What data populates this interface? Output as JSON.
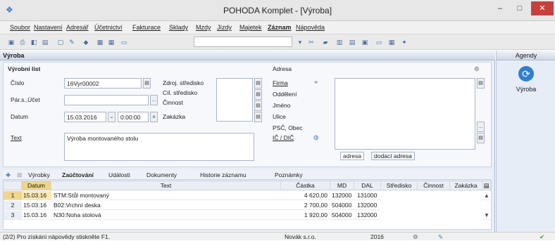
{
  "window": {
    "title": "POHODA Komplet - [Výroba]",
    "min": "–",
    "max": "□",
    "close": "✕"
  },
  "menu": [
    "Soubor",
    "Nastavení",
    "Adresář",
    "Účetnictví",
    "Fakturace",
    "Sklady",
    "Mzdy",
    "Jízdy",
    "Majetek",
    "Záznam",
    "Nápověda"
  ],
  "form": {
    "panel_title": "Výroba",
    "section": "Výrobní list",
    "cislo_label": "Číslo",
    "cislo": "16Vyr00002",
    "pars_label": "Pár.s.,Účet",
    "datum_label": "Datum",
    "datum": "15.03.2016",
    "cas": "0:00:00",
    "text_label": "Text",
    "text": "Výroba montovaného stolu",
    "zdroj_label": "Zdroj. středisko",
    "cil_label": "Cíl. středisko",
    "cinnost_label": "Činnost",
    "zakazka_label": "Zakázka",
    "adresa_label": "Adresa",
    "firma_label": "Firma",
    "oddeleni_label": "Oddělení",
    "jmeno_label": "Jméno",
    "ulice_label": "Ulice",
    "psc_label": "PSČ, Obec",
    "ic_label": "IČ / DIČ",
    "addr_tab1": "adresa",
    "addr_tab2": "dodací adresa"
  },
  "agenda": {
    "title": "Agendy",
    "item": "Výroba"
  },
  "tabs": [
    "Výrobky",
    "Zaúčtování",
    "Události",
    "Dokumenty",
    "Historie záznamu",
    "Poznámky"
  ],
  "grid": {
    "headers": [
      "Datum",
      "Text",
      "Částka",
      "MD",
      "DAL",
      "Středisko",
      "Činnost",
      "Zakázka"
    ],
    "rows": [
      {
        "n": "1",
        "datum": "15.03.16",
        "text": "STM:Stůl montovaný",
        "castka": "4 620,00",
        "md": "132000",
        "dal": "131000"
      },
      {
        "n": "2",
        "datum": "15.03.16",
        "text": "B02:Vrchní deska",
        "castka": "2 700,00",
        "md": "504000",
        "dal": "132000"
      },
      {
        "n": "3",
        "datum": "15.03.16",
        "text": "N30:Noha stolová",
        "castka": "1 920,00",
        "md": "504000",
        "dal": "132000"
      }
    ]
  },
  "status": {
    "hint": "(2/2) Pro získání nápovědy stiskněte F1.",
    "company": "Novák s.r.o.",
    "year": "2016"
  }
}
